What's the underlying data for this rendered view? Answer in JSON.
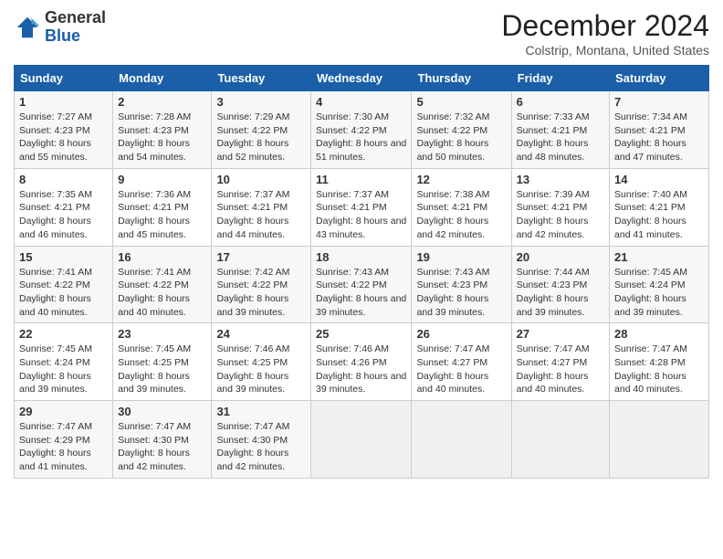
{
  "header": {
    "logo_line1": "General",
    "logo_line2": "Blue",
    "month_title": "December 2024",
    "location": "Colstrip, Montana, United States"
  },
  "days_of_week": [
    "Sunday",
    "Monday",
    "Tuesday",
    "Wednesday",
    "Thursday",
    "Friday",
    "Saturday"
  ],
  "weeks": [
    [
      {
        "day": "1",
        "sunrise": "Sunrise: 7:27 AM",
        "sunset": "Sunset: 4:23 PM",
        "daylight": "Daylight: 8 hours and 55 minutes."
      },
      {
        "day": "2",
        "sunrise": "Sunrise: 7:28 AM",
        "sunset": "Sunset: 4:23 PM",
        "daylight": "Daylight: 8 hours and 54 minutes."
      },
      {
        "day": "3",
        "sunrise": "Sunrise: 7:29 AM",
        "sunset": "Sunset: 4:22 PM",
        "daylight": "Daylight: 8 hours and 52 minutes."
      },
      {
        "day": "4",
        "sunrise": "Sunrise: 7:30 AM",
        "sunset": "Sunset: 4:22 PM",
        "daylight": "Daylight: 8 hours and 51 minutes."
      },
      {
        "day": "5",
        "sunrise": "Sunrise: 7:32 AM",
        "sunset": "Sunset: 4:22 PM",
        "daylight": "Daylight: 8 hours and 50 minutes."
      },
      {
        "day": "6",
        "sunrise": "Sunrise: 7:33 AM",
        "sunset": "Sunset: 4:21 PM",
        "daylight": "Daylight: 8 hours and 48 minutes."
      },
      {
        "day": "7",
        "sunrise": "Sunrise: 7:34 AM",
        "sunset": "Sunset: 4:21 PM",
        "daylight": "Daylight: 8 hours and 47 minutes."
      }
    ],
    [
      {
        "day": "8",
        "sunrise": "Sunrise: 7:35 AM",
        "sunset": "Sunset: 4:21 PM",
        "daylight": "Daylight: 8 hours and 46 minutes."
      },
      {
        "day": "9",
        "sunrise": "Sunrise: 7:36 AM",
        "sunset": "Sunset: 4:21 PM",
        "daylight": "Daylight: 8 hours and 45 minutes."
      },
      {
        "day": "10",
        "sunrise": "Sunrise: 7:37 AM",
        "sunset": "Sunset: 4:21 PM",
        "daylight": "Daylight: 8 hours and 44 minutes."
      },
      {
        "day": "11",
        "sunrise": "Sunrise: 7:37 AM",
        "sunset": "Sunset: 4:21 PM",
        "daylight": "Daylight: 8 hours and 43 minutes."
      },
      {
        "day": "12",
        "sunrise": "Sunrise: 7:38 AM",
        "sunset": "Sunset: 4:21 PM",
        "daylight": "Daylight: 8 hours and 42 minutes."
      },
      {
        "day": "13",
        "sunrise": "Sunrise: 7:39 AM",
        "sunset": "Sunset: 4:21 PM",
        "daylight": "Daylight: 8 hours and 42 minutes."
      },
      {
        "day": "14",
        "sunrise": "Sunrise: 7:40 AM",
        "sunset": "Sunset: 4:21 PM",
        "daylight": "Daylight: 8 hours and 41 minutes."
      }
    ],
    [
      {
        "day": "15",
        "sunrise": "Sunrise: 7:41 AM",
        "sunset": "Sunset: 4:22 PM",
        "daylight": "Daylight: 8 hours and 40 minutes."
      },
      {
        "day": "16",
        "sunrise": "Sunrise: 7:41 AM",
        "sunset": "Sunset: 4:22 PM",
        "daylight": "Daylight: 8 hours and 40 minutes."
      },
      {
        "day": "17",
        "sunrise": "Sunrise: 7:42 AM",
        "sunset": "Sunset: 4:22 PM",
        "daylight": "Daylight: 8 hours and 39 minutes."
      },
      {
        "day": "18",
        "sunrise": "Sunrise: 7:43 AM",
        "sunset": "Sunset: 4:22 PM",
        "daylight": "Daylight: 8 hours and 39 minutes."
      },
      {
        "day": "19",
        "sunrise": "Sunrise: 7:43 AM",
        "sunset": "Sunset: 4:23 PM",
        "daylight": "Daylight: 8 hours and 39 minutes."
      },
      {
        "day": "20",
        "sunrise": "Sunrise: 7:44 AM",
        "sunset": "Sunset: 4:23 PM",
        "daylight": "Daylight: 8 hours and 39 minutes."
      },
      {
        "day": "21",
        "sunrise": "Sunrise: 7:45 AM",
        "sunset": "Sunset: 4:24 PM",
        "daylight": "Daylight: 8 hours and 39 minutes."
      }
    ],
    [
      {
        "day": "22",
        "sunrise": "Sunrise: 7:45 AM",
        "sunset": "Sunset: 4:24 PM",
        "daylight": "Daylight: 8 hours and 39 minutes."
      },
      {
        "day": "23",
        "sunrise": "Sunrise: 7:45 AM",
        "sunset": "Sunset: 4:25 PM",
        "daylight": "Daylight: 8 hours and 39 minutes."
      },
      {
        "day": "24",
        "sunrise": "Sunrise: 7:46 AM",
        "sunset": "Sunset: 4:25 PM",
        "daylight": "Daylight: 8 hours and 39 minutes."
      },
      {
        "day": "25",
        "sunrise": "Sunrise: 7:46 AM",
        "sunset": "Sunset: 4:26 PM",
        "daylight": "Daylight: 8 hours and 39 minutes."
      },
      {
        "day": "26",
        "sunrise": "Sunrise: 7:47 AM",
        "sunset": "Sunset: 4:27 PM",
        "daylight": "Daylight: 8 hours and 40 minutes."
      },
      {
        "day": "27",
        "sunrise": "Sunrise: 7:47 AM",
        "sunset": "Sunset: 4:27 PM",
        "daylight": "Daylight: 8 hours and 40 minutes."
      },
      {
        "day": "28",
        "sunrise": "Sunrise: 7:47 AM",
        "sunset": "Sunset: 4:28 PM",
        "daylight": "Daylight: 8 hours and 40 minutes."
      }
    ],
    [
      {
        "day": "29",
        "sunrise": "Sunrise: 7:47 AM",
        "sunset": "Sunset: 4:29 PM",
        "daylight": "Daylight: 8 hours and 41 minutes."
      },
      {
        "day": "30",
        "sunrise": "Sunrise: 7:47 AM",
        "sunset": "Sunset: 4:30 PM",
        "daylight": "Daylight: 8 hours and 42 minutes."
      },
      {
        "day": "31",
        "sunrise": "Sunrise: 7:47 AM",
        "sunset": "Sunset: 4:30 PM",
        "daylight": "Daylight: 8 hours and 42 minutes."
      },
      null,
      null,
      null,
      null
    ]
  ]
}
